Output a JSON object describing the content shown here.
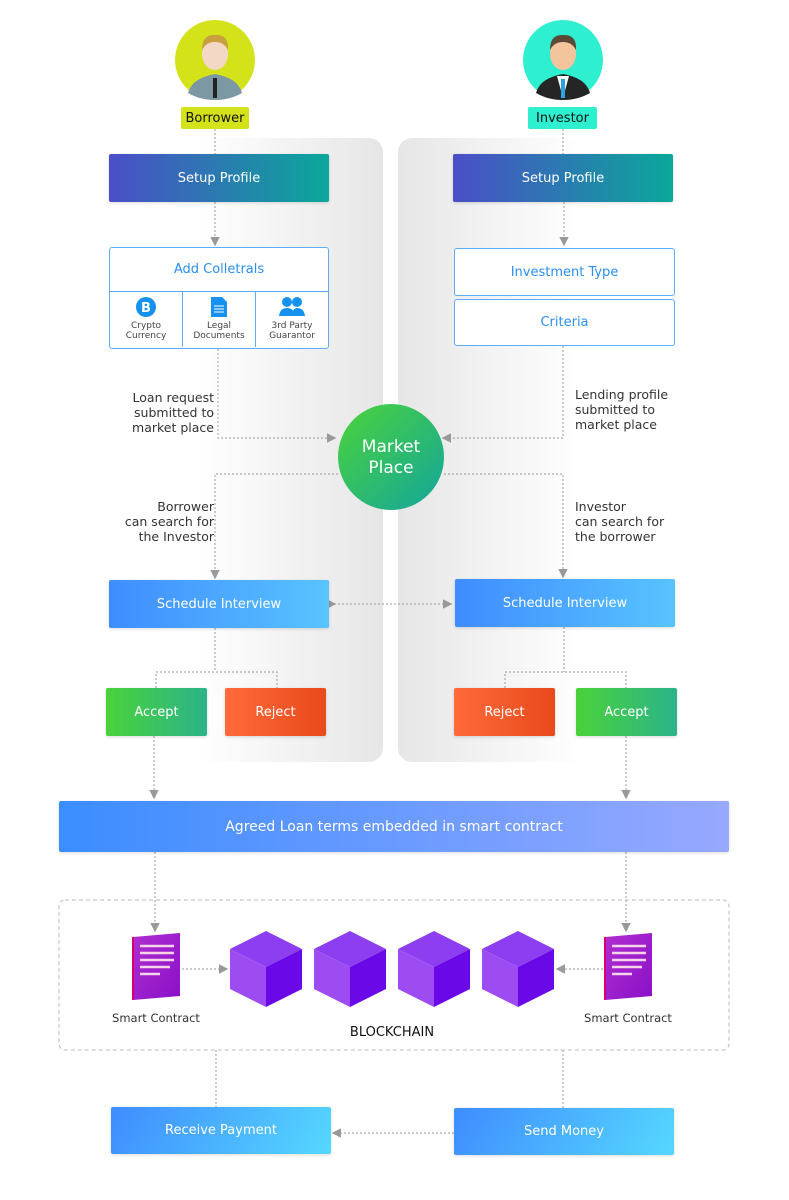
{
  "borrower": {
    "label": "Borrower",
    "color": "#d4e21a",
    "setup": "Setup Profile",
    "collaterals": {
      "title": "Add Colletrals",
      "items": [
        {
          "icon": "bitcoin-icon",
          "label": "Crypto Currency"
        },
        {
          "icon": "document-icon",
          "label": "Legal Documents"
        },
        {
          "icon": "people-icon",
          "label": "3rd Party Guarantor"
        }
      ]
    },
    "note1": [
      "Loan request",
      "submitted to",
      "market place"
    ],
    "note2": [
      "Borrower",
      "can search for",
      "the Investor"
    ],
    "schedule": "Schedule Interview",
    "accept": "Accept",
    "reject": "Reject",
    "smart_contract": "Smart Contract",
    "payment": "Receive Payment"
  },
  "investor": {
    "label": "Investor",
    "color": "#2ef0d0",
    "setup": "Setup Profile",
    "investment_type": "Investment Type",
    "criteria": "Criteria",
    "note1": [
      "Lending profile",
      "submitted to",
      "market place"
    ],
    "note2": [
      "Investor",
      "can search for",
      "the borrower"
    ],
    "schedule": "Schedule Interview",
    "accept": "Accept",
    "reject": "Reject",
    "smart_contract": "Smart Contract",
    "payment": "Send Money"
  },
  "market_place": [
    "Market",
    "Place"
  ],
  "agreed": "Agreed Loan terms embedded in smart contract",
  "blockchain": "BLOCKCHAIN"
}
